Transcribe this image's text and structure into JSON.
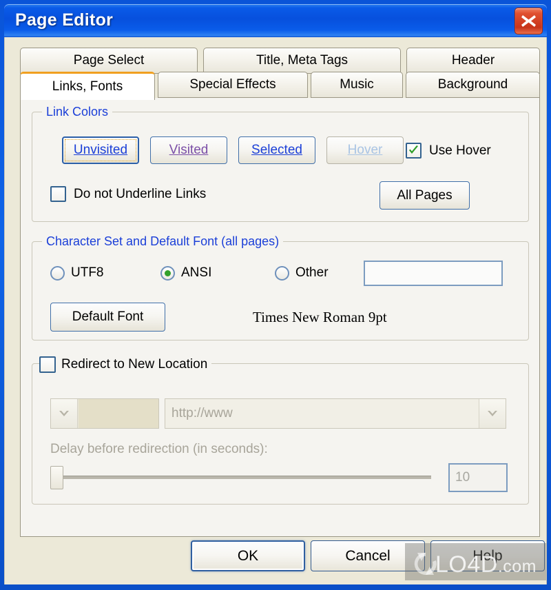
{
  "window": {
    "title": "Page Editor",
    "close_icon": "close-icon",
    "accent_titlebar": "#0a5ae8",
    "close_button_color": "#c8341a",
    "dialog_background": "#ece9d8",
    "tabbody_background": "#f5f4f0",
    "active_tab_accent": "#f0a020",
    "legend_color": "#1b3fd8"
  },
  "tabs": {
    "row1": [
      {
        "label": "Page Select",
        "active": false
      },
      {
        "label": "Title, Meta Tags",
        "active": false
      },
      {
        "label": "Header",
        "active": false
      }
    ],
    "row2": [
      {
        "label": "Links, Fonts",
        "active": true
      },
      {
        "label": "Special Effects",
        "active": false
      },
      {
        "label": "Music",
        "active": false
      },
      {
        "label": "Background",
        "active": false
      }
    ]
  },
  "link_colors": {
    "legend": "Link Colors",
    "buttons": [
      {
        "label": "Unvisited",
        "state": "focused",
        "text_color": "#1b3fd8"
      },
      {
        "label": "Visited",
        "state": "normal",
        "text_color": "#7b4fa8"
      },
      {
        "label": "Selected",
        "state": "normal",
        "text_color": "#1b3fd8"
      },
      {
        "label": "Hover",
        "state": "disabled",
        "text_color": "#a9c4e4"
      }
    ],
    "use_hover": {
      "label": "Use Hover",
      "checked": true
    },
    "do_not_underline": {
      "label": "Do not Underline Links",
      "checked": false
    },
    "all_pages_button": "All Pages"
  },
  "charset": {
    "legend": "Character Set and Default Font (all pages)",
    "options": [
      {
        "label": "UTF8",
        "selected": false
      },
      {
        "label": "ANSI",
        "selected": true
      },
      {
        "label": "Other",
        "selected": false
      }
    ],
    "other_value": "",
    "other_placeholder": "",
    "default_font_button": "Default Font",
    "current_font": "Times New Roman  9pt",
    "selected_dot_color": "#32a02c"
  },
  "redirect": {
    "legend": "Redirect to New Location",
    "enabled": false,
    "protocol_value": "",
    "url_value": "http://www",
    "delay_label": "Delay before redirection  (in seconds):",
    "delay_value": "10",
    "delay_slider_percent": 0
  },
  "footer": {
    "ok": "OK",
    "cancel": "Cancel",
    "help": "Help"
  },
  "watermark": {
    "text": "LO4D",
    "suffix": ".com",
    "logo_icon": "refresh-circle-icon"
  }
}
